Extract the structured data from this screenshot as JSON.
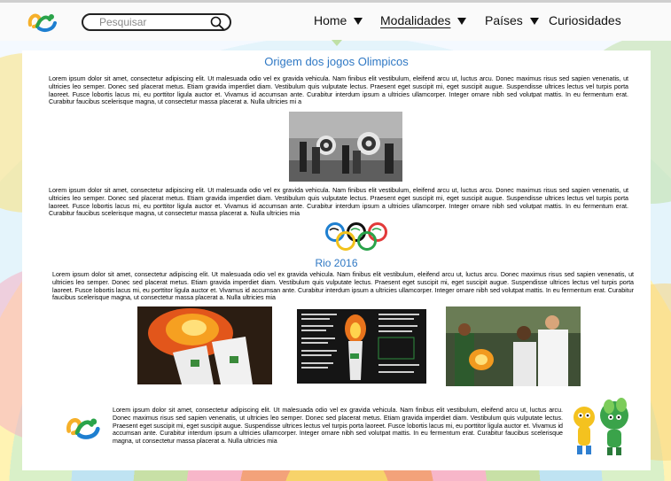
{
  "header": {
    "search_placeholder": "Pesquisar",
    "nav": [
      {
        "label": "Home",
        "has_dropdown": true,
        "active": false
      },
      {
        "label": "Modalidades",
        "has_dropdown": true,
        "active": true
      },
      {
        "label": "Países",
        "has_dropdown": true,
        "active": false
      },
      {
        "label": "Curiosidades",
        "has_dropdown": false,
        "active": false
      }
    ]
  },
  "main": {
    "title": "Origem dos jogos Olimpicos",
    "paragraph1": "Lorem ipsum dolor sit amet, consectetur adipiscing elit. Ut malesuada odio vel ex gravida vehicula. Nam finibus elit vestibulum, eleifend arcu ut, luctus arcu. Donec maximus risus sed sapien venenatis, ut ultricies leo semper. Donec sed placerat metus. Etiam gravida imperdiet diam. Vestibulum quis vulputate lectus. Praesent eget suscipit mi, eget suscipit augue. Suspendisse ultrices lectus vel turpis porta laoreet. Fusce lobortis lacus mi, eu porttitor ligula auctor et. Vivamus id accumsan ante. Curabitur interdum ipsum a ultricies ullamcorper. Integer ornare nibh sed volutpat mattis. In eu fermentum erat. Curabitur faucibus scelerisque magna, ut consectetur massa placerat a. Nulla ultricies mi a",
    "paragraph2": "Lorem ipsum dolor sit amet, consectetur adipiscing elit. Ut malesuada odio vel ex gravida vehicula. Nam finibus elit vestibulum, eleifend arcu ut, luctus arcu. Donec maximus risus sed sapien venenatis, ut ultricies leo semper. Donec sed placerat metus. Etiam gravida imperdiet diam. Vestibulum quis vulputate lectus. Praesent eget suscipit mi, eget suscipit augue. Suspendisse ultrices lectus vel turpis porta laoreet. Fusce lobortis lacus mi, eu porttitor ligula auctor et. Vivamus id accumsan ante. Curabitur interdum ipsum a ultricies ullamcorper. Integer ornare nibh sed volutpat mattis. In eu fermentum erat. Curabitur faucibus scelerisque magna, ut consectetur massa placerat a. Nulla ultricies mia",
    "subtitle": "Rio 2016",
    "paragraph3": "Lorem ipsum dolor sit amet, consectetur adipiscing elit. Ut malesuada odio vel ex gravida vehicula. Nam finibus elit vestibulum, eleifend arcu ut, luctus arcu. Donec maximus risus sed sapien venenatis, ut ultricies leo semper. Donec sed placerat metus. Etiam gravida imperdiet diam. Vestibulum quis vulputate lectus. Praesent eget suscipit mi, eget suscipit augue. Suspendisse ultrices lectus vel turpis porta laoreet. Fusce lobortis lacus mi, eu porttitor ligula auctor et. Vivamus id accumsan ante. Curabitur interdum ipsum a ultricies ullamcorper. Integer ornare nibh sed volutpat mattis. In eu fermentum erat. Curabitur faucibus scelerisque magna, ut consectetur massa placerat a. Nulla ultricies mia",
    "paragraph4": "Lorem ipsum dolor sit amet, consectetur adipiscing elit. Ut malesuada odio vel ex gravida vehicula. Nam finibus elit vestibulum, eleifend arcu ut, luctus arcu. Donec maximus risus sed sapien venenatis, ut ultricies leo semper. Donec sed placerat metus. Etiam gravida imperdiet diam. Vestibulum quis vulputate lectus. Praesent eget suscipit mi, eget suscipit augue. Suspendisse ultrices lectus vel turpis porta laoreet. Fusce lobortis lacus mi, eu porttitor ligula auctor et. Vivamus id accumsan ante. Curabitur interdum ipsum a ultricies ullamcorper. Integer ornare nibh sed volutpat mattis. In eu fermentum erat. Curabitur faucibus scelerisque magna, ut consectetur massa placerat a. Nulla ultricies mia"
  },
  "icons": {
    "logo": "rio2016-logo",
    "search": "search-icon",
    "rings": "olympic-rings-icon",
    "mascot": "rio2016-mascots"
  },
  "colors": {
    "title": "#2f78c4",
    "ring_blue": "#1e7fd0",
    "ring_black": "#111111",
    "ring_red": "#e23a3a",
    "ring_yellow": "#f2c21b",
    "ring_green": "#2aa34a"
  }
}
